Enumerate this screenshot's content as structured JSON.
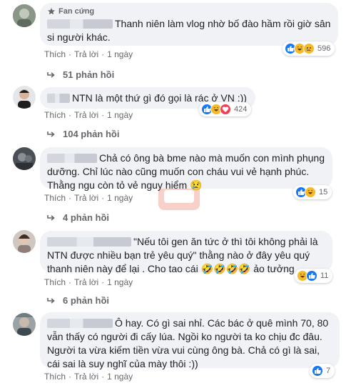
{
  "comments": [
    {
      "badge": "Fan cứng",
      "text": "Thanh niên làm vlog nhờ bố đào hầm rồi giờ sân si người khác.",
      "actions": {
        "like": "Thích",
        "reply": "Trả lời",
        "time": "1 ngày"
      },
      "reactions": [
        "like",
        "haha",
        "sad"
      ],
      "reaction_count": "596",
      "replies_label": "51 phản hồi"
    },
    {
      "text": "NTN là một thứ gì đó gọi là rác ở VN :))",
      "actions": {
        "like": "Thích",
        "reply": "Trả lời",
        "time": "1 ngày"
      },
      "reactions": [
        "like",
        "haha",
        "love"
      ],
      "reaction_count": "424",
      "replies_label": "104 phản hồi"
    },
    {
      "text": "Chả có ông bà bme nào mà muốn con mình phụng dưỡng. Chỉ lúc nào cũng muốn con cháu vui vẻ hạnh phúc. Thằng ngu còn tỏ vẻ nguy hiểm 😢",
      "actions": {
        "like": "Thích",
        "reply": "Trả lời",
        "time": "1 ngày"
      },
      "reactions": [
        "like",
        "haha"
      ],
      "reaction_count": "15",
      "replies_label": "4 phản hồi"
    },
    {
      "text": "\"Nếu tôi gen ăn tức ở thì tôi không phải là NTN được nhiều bạn trẻ yêu quý\" thằng nào ở đây yêu quý thanh niên này để lại . Cho tao cái 🤣🤣🤣🤣 ảo tưởng",
      "actions": {
        "like": "Thích",
        "reply": "Trả lời",
        "time": "1 ngày"
      },
      "reactions": [
        "haha",
        "like"
      ],
      "reaction_count": "11",
      "replies_label": "6 phản hồi"
    },
    {
      "text": "Ô hay. Có gì sai nhỉ. Các bác ở quê mình 70, 80 vẫn thấy có người đi cấy lúa. Ngồi ko người ta ko chịu đc đâu. Người ta vừa kiếm tiền vừa vui cùng ông bà. Chả có gì là sai, cái sai là suy nghĩ của mày thôi :))",
      "actions": {
        "like": "Thích",
        "reply": "Trả lời",
        "time": "1 ngày"
      },
      "reactions": [
        "like"
      ],
      "reaction_count": "7"
    }
  ],
  "colors": {
    "bubble": "#f0f2f5",
    "meta": "#65676b",
    "like": "#1877f2",
    "love": "#f33e58",
    "haha": "#f7b928"
  }
}
